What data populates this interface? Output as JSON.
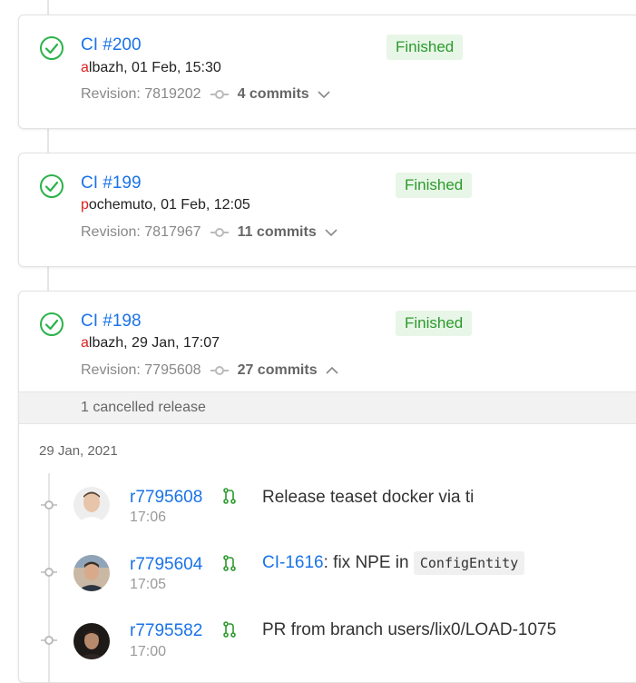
{
  "builds": [
    {
      "title": "CI #200",
      "author_first": "a",
      "author_rest": "lbazh, 01 Feb, 15:30",
      "status": "Finished",
      "revision_label": "Revision:",
      "revision": "7819202",
      "commits": "4 commits",
      "expanded": false
    },
    {
      "title": "CI #199",
      "author_first": "p",
      "author_rest": "ochemuto, 01 Feb, 12:05",
      "status": "Finished",
      "revision_label": "Revision:",
      "revision": "7817967",
      "commits": "11 commits",
      "expanded": false
    },
    {
      "title": "CI #198",
      "author_first": "a",
      "author_rest": "lbazh, 29 Jan, 17:07",
      "status": "Finished",
      "revision_label": "Revision:",
      "revision": "7795608",
      "commits": "27 commits",
      "expanded": true,
      "cancelled_text": "1 cancelled release",
      "date_header": "29 Jan, 2021",
      "commit_list": [
        {
          "rev": "r7795608",
          "time": "17:06",
          "message": "Release teaset docker via ti",
          "ticket": "",
          "message_suffix": "",
          "code": ""
        },
        {
          "rev": "r7795604",
          "time": "17:05",
          "message": "",
          "ticket": "CI-1616",
          "message_suffix": ": fix NPE in ",
          "code": "ConfigEntity"
        },
        {
          "rev": "r7795582",
          "time": "17:00",
          "message": "PR from branch users/lix0/LOAD-1075",
          "ticket": "",
          "message_suffix": "",
          "code": ""
        }
      ]
    }
  ],
  "colors": {
    "link": "#1a73e8",
    "success": "#2b9a2b",
    "author_initial": "#e02020"
  },
  "icons": {
    "status": "check-circle-icon",
    "commit": "commit-icon",
    "merge": "merge-request-icon",
    "expand": "chevron-down-icon",
    "collapse": "chevron-up-icon"
  }
}
